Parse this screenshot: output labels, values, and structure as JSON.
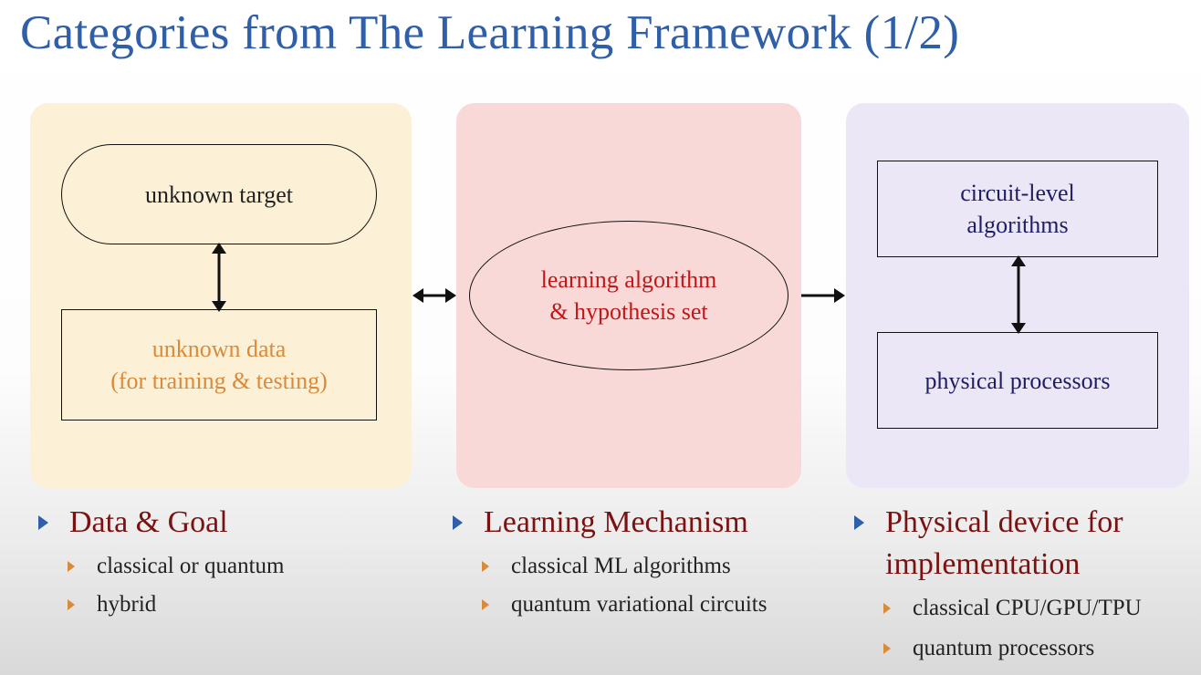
{
  "title": "Categories from The Learning Framework (1/2)",
  "colors": {
    "title": "#2f5fa8",
    "heading": "#7a1212",
    "panel_data": "#fcf1d6",
    "panel_learning": "#f9d8d8",
    "panel_device": "#ebe7f7",
    "unknown_data_text": "#d98a3a",
    "learning_text": "#c01818",
    "device_text": "#1e1e60",
    "sub_bullet": "#d98a3a",
    "head_bullet": "#2f5fa8"
  },
  "diagram": {
    "data_panel": {
      "unknown_target": "unknown target",
      "unknown_data_line1": "unknown data",
      "unknown_data_line2": "(for training & testing)"
    },
    "learning_panel": {
      "line1": "learning algorithm",
      "line2": "& hypothesis set"
    },
    "device_panel": {
      "circuit_line1": "circuit-level",
      "circuit_line2": "algorithms",
      "processors": "physical processors"
    }
  },
  "captions": {
    "data": {
      "heading": "Data & Goal",
      "items": [
        "classical or quantum",
        "hybrid"
      ]
    },
    "learning": {
      "heading": "Learning Mechanism",
      "items": [
        "classical ML algorithms",
        "quantum variational circuits"
      ]
    },
    "device": {
      "heading_line1": "Physical device for",
      "heading_line2": "implementation",
      "items": [
        "classical CPU/GPU/TPU",
        "quantum processors"
      ]
    }
  }
}
